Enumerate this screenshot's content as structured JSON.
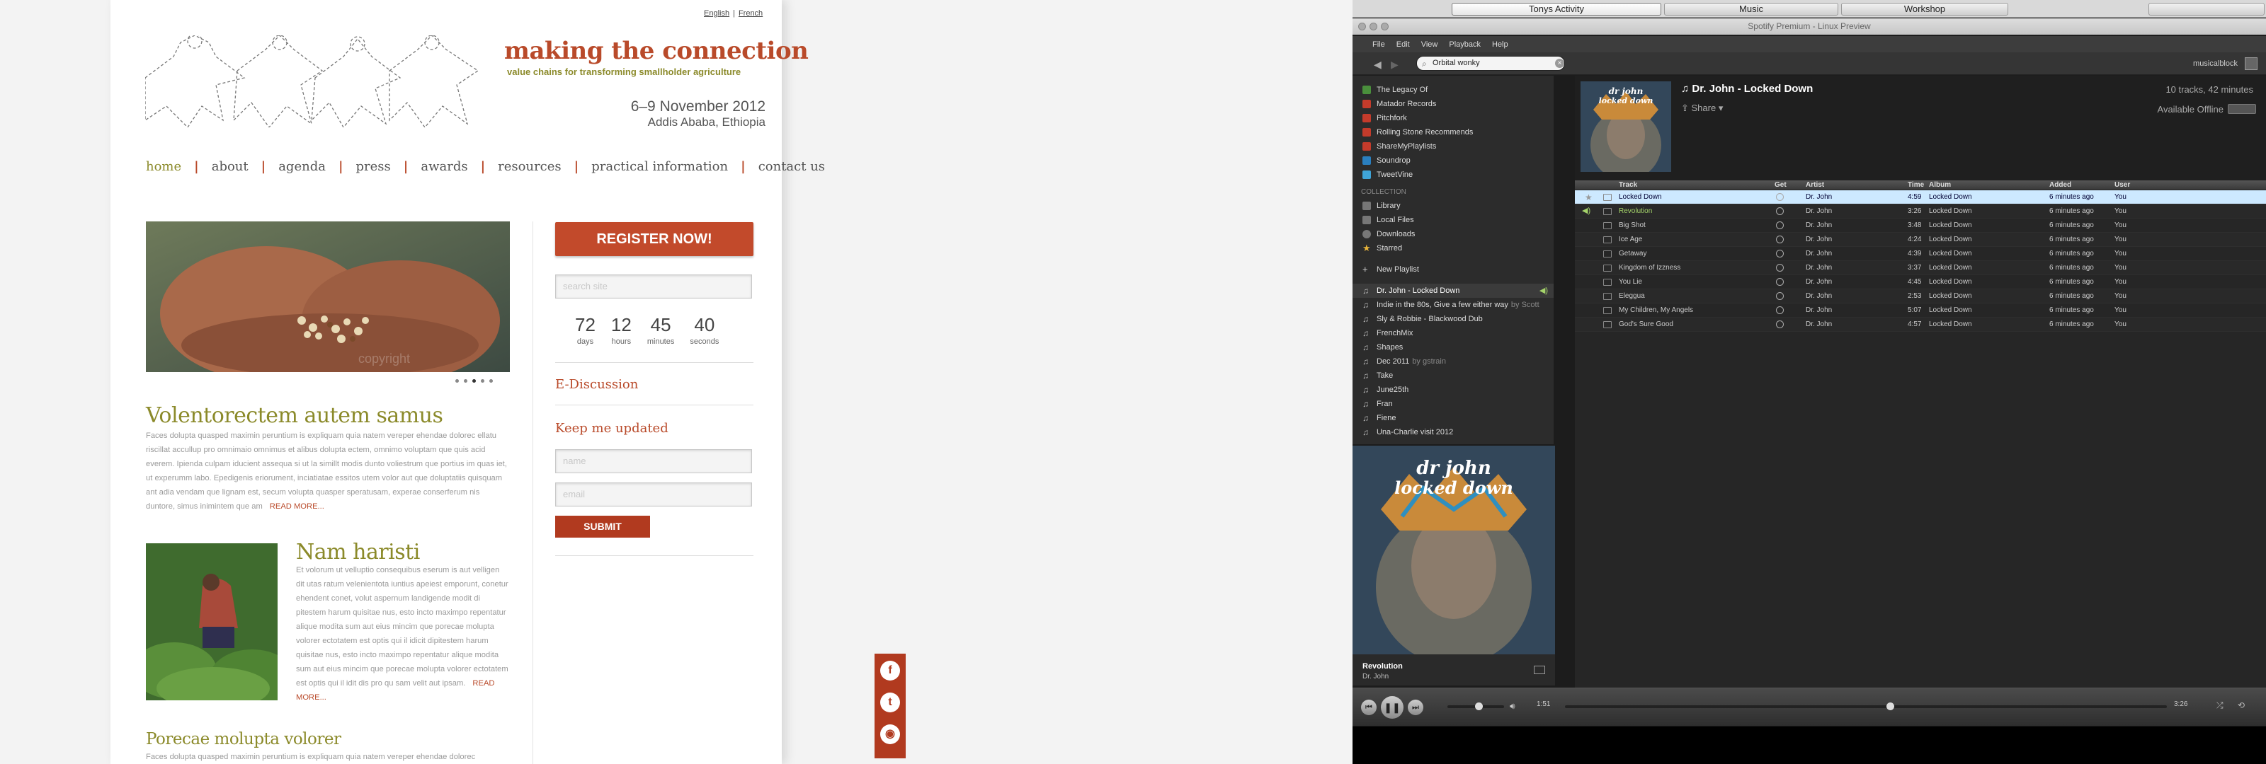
{
  "web": {
    "lang": {
      "english": "English",
      "french": "French",
      "sep": "|"
    },
    "title": "making the connection",
    "subtitle": "value chains for transforming smallholder agriculture",
    "date": "6–9 November 2012",
    "place": "Addis Ababa, Ethiopia",
    "nav": [
      "home",
      "about",
      "agenda",
      "press",
      "awards",
      "resources",
      "practical information",
      "contact us"
    ],
    "nav_sep": "|",
    "hero_watermark": "copyright",
    "article1": {
      "title": "Volentorectem autem samus",
      "body": "Faces dolupta quasped maximin peruntium is expliquam quia natem vereper ehendae dolorec ellatu riscillat accullup pro omnimaio omnimus et alibus dolupta ectem, omnimo voluptam que quis acid everem. Ipienda culpam iducient assequa si ut la simillt modis dunto voliestrum que portius im quas iet, ut experumm labo. Epedigenis eriorument, inciatiatae essitos utem volor aut que doluptatiis quisquam ant adia vendam que lignam est, secum volupta quasper speratusam, experae conserferum nis duntore, simus inimintem que am",
      "readmore": "READ MORE..."
    },
    "article2": {
      "title": "Nam haristi",
      "body": "Et volorum ut velluptio consequibus eserum is aut velligen dit utas ratum velenientota iuntius apeiest emporunt, conetur ehendent conet, volut aspernum landigende modit di pitestem harum quisitae nus, esto incto maximpo repentatur alique modita sum aut eius mincim que porecae molupta volorer ectotatem est optis qui il idicit dipitestem harum quisitae nus, esto incto maximpo repentatur alique modita sum aut eius mincim que porecae molupta volorer ectotatem est optis qui il idit dis pro qu sam velit aut ipsam.",
      "readmore": "READ MORE..."
    },
    "article3": {
      "title": "Porecae molupta volorer",
      "body": "Faces dolupta quasped maximin peruntium is expliquam quia natem vereper ehendae dolorec"
    },
    "register": "REGISTER NOW!",
    "search_placeholder": "search site",
    "countdown": [
      {
        "n": "72",
        "l": "days"
      },
      {
        "n": "12",
        "l": "hours"
      },
      {
        "n": "45",
        "l": "minutes"
      },
      {
        "n": "40",
        "l": "seconds"
      }
    ],
    "ediscussion": "E-Discussion",
    "keep_updated": "Keep me updated",
    "name_placeholder": "name",
    "email_placeholder": "email",
    "submit": "SUBMIT",
    "social_icons": [
      "facebook-icon",
      "twitter-icon",
      "rss-icon"
    ],
    "social_glyphs": [
      "f",
      "t",
      "◉"
    ]
  },
  "desktop": {
    "taskbar": [
      "Tonys Activity",
      "Music",
      "Workshop"
    ],
    "window_title": "Spotify Premium - Linux Preview",
    "menu": [
      "File",
      "Edit",
      "View",
      "Playback",
      "Help"
    ],
    "search_value": "Orbital wonky",
    "username": "musicalblock",
    "sidebar_top": [
      {
        "label": "The Legacy Of",
        "color": "#4a8f3c"
      },
      {
        "label": "Matador Records",
        "color": "#c43b2b"
      },
      {
        "label": "Pitchfork",
        "color": "#c43b2b"
      },
      {
        "label": "Rolling Stone Recommends",
        "color": "#c43b2b"
      },
      {
        "label": "ShareMyPlaylists",
        "color": "#c43b2b"
      },
      {
        "label": "Soundrop",
        "color": "#2a7fbf"
      },
      {
        "label": "TweetVine",
        "color": "#3fa4d8"
      }
    ],
    "collection_header": "COLLECTION",
    "collection": [
      "Library",
      "Local Files",
      "Downloads",
      "Starred"
    ],
    "new_playlist": "New Playlist",
    "playlists": [
      {
        "label": "Dr. John - Locked Down",
        "by": ""
      },
      {
        "label": "Indie in the 80s, Give a few either way",
        "by": "by Scott"
      },
      {
        "label": "Sly &amp; Robbie - Blackwood Dub",
        "by": ""
      },
      {
        "label": "FrenchMix",
        "by": ""
      },
      {
        "label": "Shapes",
        "by": ""
      },
      {
        "label": "Dec 2011",
        "by": "by gstrain"
      },
      {
        "label": "Take",
        "by": ""
      },
      {
        "label": "June25th",
        "by": ""
      },
      {
        "label": "Fran",
        "by": ""
      },
      {
        "label": "Fiene",
        "by": ""
      },
      {
        "label": "Una-Charlie visit 2012",
        "by": ""
      }
    ],
    "playlist_title": "Dr. John - Locked Down",
    "playlist_meta": "10 tracks, 42 minutes",
    "share": "Share",
    "available_offline": "Available Offline",
    "columns": [
      "Track",
      "Get",
      "Artist",
      "Time",
      "Album",
      "Added",
      "User"
    ],
    "tracks": [
      {
        "track": "Locked Down",
        "artist": "Dr. John",
        "time": "4:59",
        "album": "Locked Down",
        "added": "6 minutes ago",
        "user": "You"
      },
      {
        "track": "Revolution",
        "artist": "Dr. John",
        "time": "3:26",
        "album": "Locked Down",
        "added": "6 minutes ago",
        "user": "You"
      },
      {
        "track": "Big Shot",
        "artist": "Dr. John",
        "time": "3:48",
        "album": "Locked Down",
        "added": "6 minutes ago",
        "user": "You"
      },
      {
        "track": "Ice Age",
        "artist": "Dr. John",
        "time": "4:24",
        "album": "Locked Down",
        "added": "6 minutes ago",
        "user": "You"
      },
      {
        "track": "Getaway",
        "artist": "Dr. John",
        "time": "4:39",
        "album": "Locked Down",
        "added": "6 minutes ago",
        "user": "You"
      },
      {
        "track": "Kingdom of Izzness",
        "artist": "Dr. John",
        "time": "3:37",
        "album": "Locked Down",
        "added": "6 minutes ago",
        "user": "You"
      },
      {
        "track": "You Lie",
        "artist": "Dr. John",
        "time": "4:45",
        "album": "Locked Down",
        "added": "6 minutes ago",
        "user": "You"
      },
      {
        "track": "Eleggua",
        "artist": "Dr. John",
        "time": "2:53",
        "album": "Locked Down",
        "added": "6 minutes ago",
        "user": "You"
      },
      {
        "track": "My Children, My Angels",
        "artist": "Dr. John",
        "time": "5:07",
        "album": "Locked Down",
        "added": "6 minutes ago",
        "user": "You"
      },
      {
        "track": "God's Sure Good",
        "artist": "Dr. John",
        "time": "4:57",
        "album": "Locked Down",
        "added": "6 minutes ago",
        "user": "You"
      }
    ],
    "art_text": [
      "dr john",
      "locked down"
    ],
    "now_playing": {
      "track": "Revolution",
      "artist": "Dr. John"
    },
    "elapsed": "1:51",
    "duration": "3:26",
    "progress_fraction": 0.54,
    "volume_fraction": 0.55
  }
}
